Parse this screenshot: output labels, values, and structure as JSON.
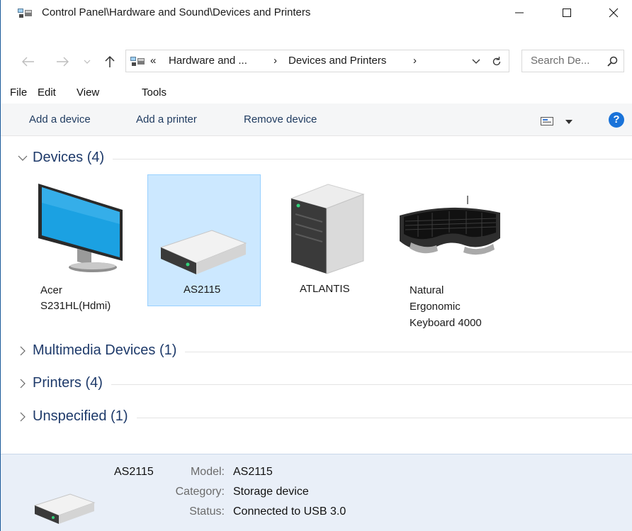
{
  "window": {
    "title": "Control Panel\\Hardware and Sound\\Devices and Printers",
    "minimize": "—",
    "maximize": "☐",
    "close": "✕"
  },
  "address_bar": {
    "overflow": "«",
    "crumbs": [
      "Hardware and ...",
      "Devices and Printers"
    ],
    "separator": "›",
    "search_placeholder": "Search De..."
  },
  "menu": [
    "File",
    "Edit",
    "View",
    "Tools"
  ],
  "commands": {
    "add_device": "Add a device",
    "add_printer": "Add a printer",
    "remove_device": "Remove device",
    "help": "?"
  },
  "groups": {
    "devices": {
      "label": "Devices (4)",
      "expanded": true
    },
    "multimedia": {
      "label": "Multimedia Devices (1)",
      "expanded": false
    },
    "printers": {
      "label": "Printers (4)",
      "expanded": false
    },
    "unspecified": {
      "label": "Unspecified (1)",
      "expanded": false
    }
  },
  "devices": [
    {
      "name_lines": [
        "Acer",
        "S231HL(Hdmi)"
      ],
      "icon": "monitor-icon",
      "selected": false
    },
    {
      "name_lines": [
        "AS2115"
      ],
      "icon": "external-drive-icon",
      "selected": true
    },
    {
      "name_lines": [
        "ATLANTIS"
      ],
      "icon": "computer-tower-icon",
      "selected": false
    },
    {
      "name_lines": [
        "Natural",
        "Ergonomic",
        "Keyboard 4000"
      ],
      "icon": "keyboard-icon",
      "selected": false
    }
  ],
  "details": {
    "name": "AS2115",
    "model_label": "Model:",
    "model": "AS2115",
    "category_label": "Category:",
    "category": "Storage device",
    "status_label": "Status:",
    "status": "Connected to USB 3.0"
  },
  "colors": {
    "selection": "#cce8ff",
    "selection_border": "#99d1ff",
    "group_text": "#1e3a6a",
    "details_bg": "#e9eff8",
    "help_blue": "#1a73d9"
  }
}
